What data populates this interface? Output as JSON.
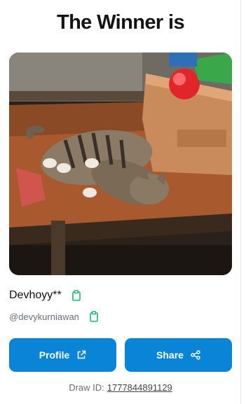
{
  "header": {
    "title": "The Winner is"
  },
  "winner": {
    "name": "Devhoyy**",
    "handle": "@devykurniawan",
    "photo_icon": "winner-photo"
  },
  "actions": {
    "profile_label": "Profile",
    "share_label": "Share"
  },
  "draw": {
    "label": "Draw ID:",
    "id": "1777844891129"
  },
  "colors": {
    "accent": "#0a84d6",
    "copy_icon": "#22b573"
  }
}
